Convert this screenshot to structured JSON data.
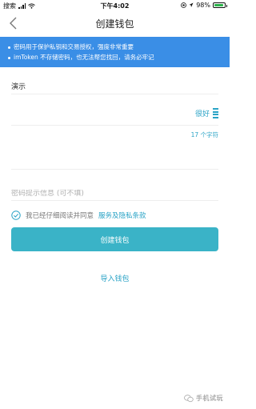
{
  "status_bar": {
    "back_app": "搜索",
    "time": "下午4:02",
    "battery_pct": "98%"
  },
  "header": {
    "title": "创建钱包"
  },
  "notice": {
    "line1": "密码用于保护私钥和交易授权，强度非常重要",
    "line2": "imToken 不存储密码，也无法帮您找回，请务必牢记"
  },
  "form": {
    "wallet_name_value": "演示",
    "password_value": "",
    "confirm_password_value": "",
    "hint_placeholder": "密码提示信息 (可不填)",
    "strength_label": "很好",
    "char_count": "17 个字符"
  },
  "agreement": {
    "text": "我已经仔细阅读并同意",
    "link": "服务及隐私条款"
  },
  "actions": {
    "create_label": "创建钱包",
    "import_label": "导入钱包"
  },
  "watermark": {
    "text": "手机试玩"
  },
  "colors": {
    "accent": "#2aa3c6",
    "notice_bg": "#3a8ee6",
    "button_bg": "#3ab3c7"
  },
  "icons": {
    "back": "chevron-left-icon",
    "check": "check-circle-icon"
  }
}
